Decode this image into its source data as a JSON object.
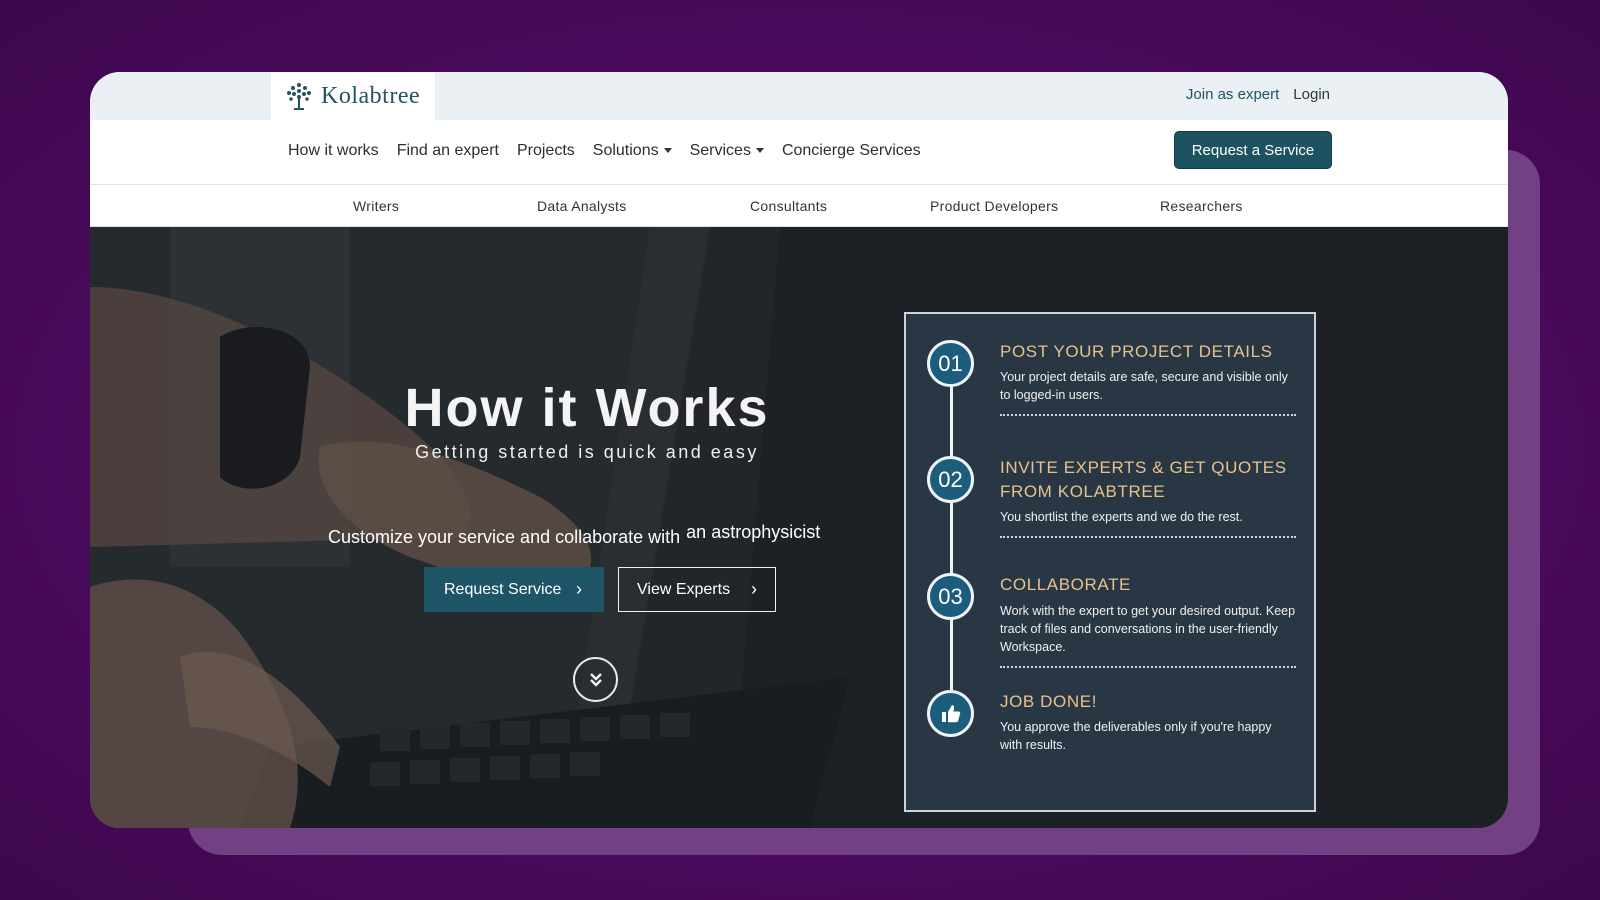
{
  "brand": {
    "name": "Kolabtree"
  },
  "top_links": {
    "join": "Join as expert",
    "login": "Login"
  },
  "nav": {
    "items": [
      {
        "label": "How it works",
        "caret": false
      },
      {
        "label": "Find an expert",
        "caret": false
      },
      {
        "label": "Projects",
        "caret": false
      },
      {
        "label": "Solutions",
        "caret": true
      },
      {
        "label": "Services",
        "caret": true
      },
      {
        "label": "Concierge Services",
        "caret": false
      }
    ],
    "cta": "Request a Service"
  },
  "subnav": [
    "Writers",
    "Data Analysts",
    "Consultants",
    "Product Developers",
    "Researchers"
  ],
  "hero": {
    "title": "How it Works",
    "subtitle": "Getting started is quick and easy",
    "customize": "Customize your service and collaborate with",
    "role": "an astrophysicist",
    "btn_request": "Request Service",
    "btn_view": "View Experts"
  },
  "steps": [
    {
      "num": "01",
      "title": "POST YOUR PROJECT DETAILS",
      "desc": "Your project details are safe, secure and visible only to logged-in users."
    },
    {
      "num": "02",
      "title": "INVITE EXPERTS & GET QUOTES FROM KOLABTREE",
      "desc": "You shortlist the experts and we do the rest."
    },
    {
      "num": "03",
      "title": "COLLABORATE",
      "desc": "Work with the expert to get your desired output. Keep track of files and conversations in the user-friendly Workspace."
    },
    {
      "num": "thumbs-up-icon",
      "title": "JOB DONE!",
      "desc": "You approve the deliverables only if you're happy with results."
    }
  ],
  "colors": {
    "background": "#4a0a5c",
    "brand_teal": "#1d5360",
    "step_title": "#e7c28c",
    "step_circle": "#1c5d7d"
  }
}
